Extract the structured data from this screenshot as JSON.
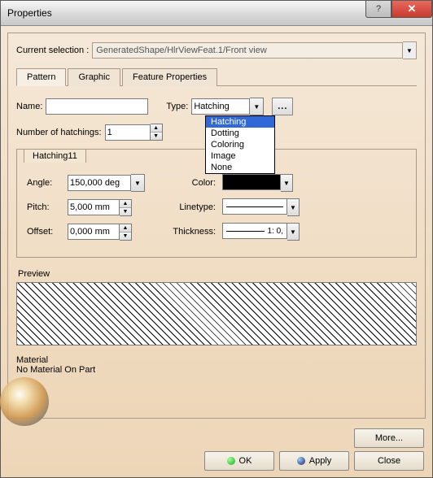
{
  "window": {
    "title": "Properties"
  },
  "selection": {
    "label": "Current selection :",
    "value": "GeneratedShape/HlrViewFeat.1/Front view"
  },
  "tabs": [
    "Pattern",
    "Graphic",
    "Feature Properties"
  ],
  "active_tab": 0,
  "name": {
    "label": "Name:",
    "value": ""
  },
  "type": {
    "label": "Type:",
    "value": "Hatching",
    "options": [
      "Hatching",
      "Dotting",
      "Coloring",
      "Image",
      "None"
    ],
    "selected_index": 0,
    "browse": "..."
  },
  "hatchings": {
    "label": "Number of hatchings:",
    "value": "1"
  },
  "group": {
    "title": "Hatching11",
    "angle": {
      "label": "Angle:",
      "value": "150,000 deg"
    },
    "pitch": {
      "label": "Pitch:",
      "value": "5,000 mm"
    },
    "offset": {
      "label": "Offset:",
      "value": "0,000 mm"
    },
    "color": {
      "label": "Color:"
    },
    "linetype": {
      "label": "Linetype:"
    },
    "thickness": {
      "label": "Thickness:",
      "value": "1: 0,"
    }
  },
  "preview": {
    "label": "Preview"
  },
  "material": {
    "label": "Material",
    "text": "No Material On Part"
  },
  "buttons": {
    "more": "More...",
    "ok": "OK",
    "apply": "Apply",
    "close": "Close"
  }
}
